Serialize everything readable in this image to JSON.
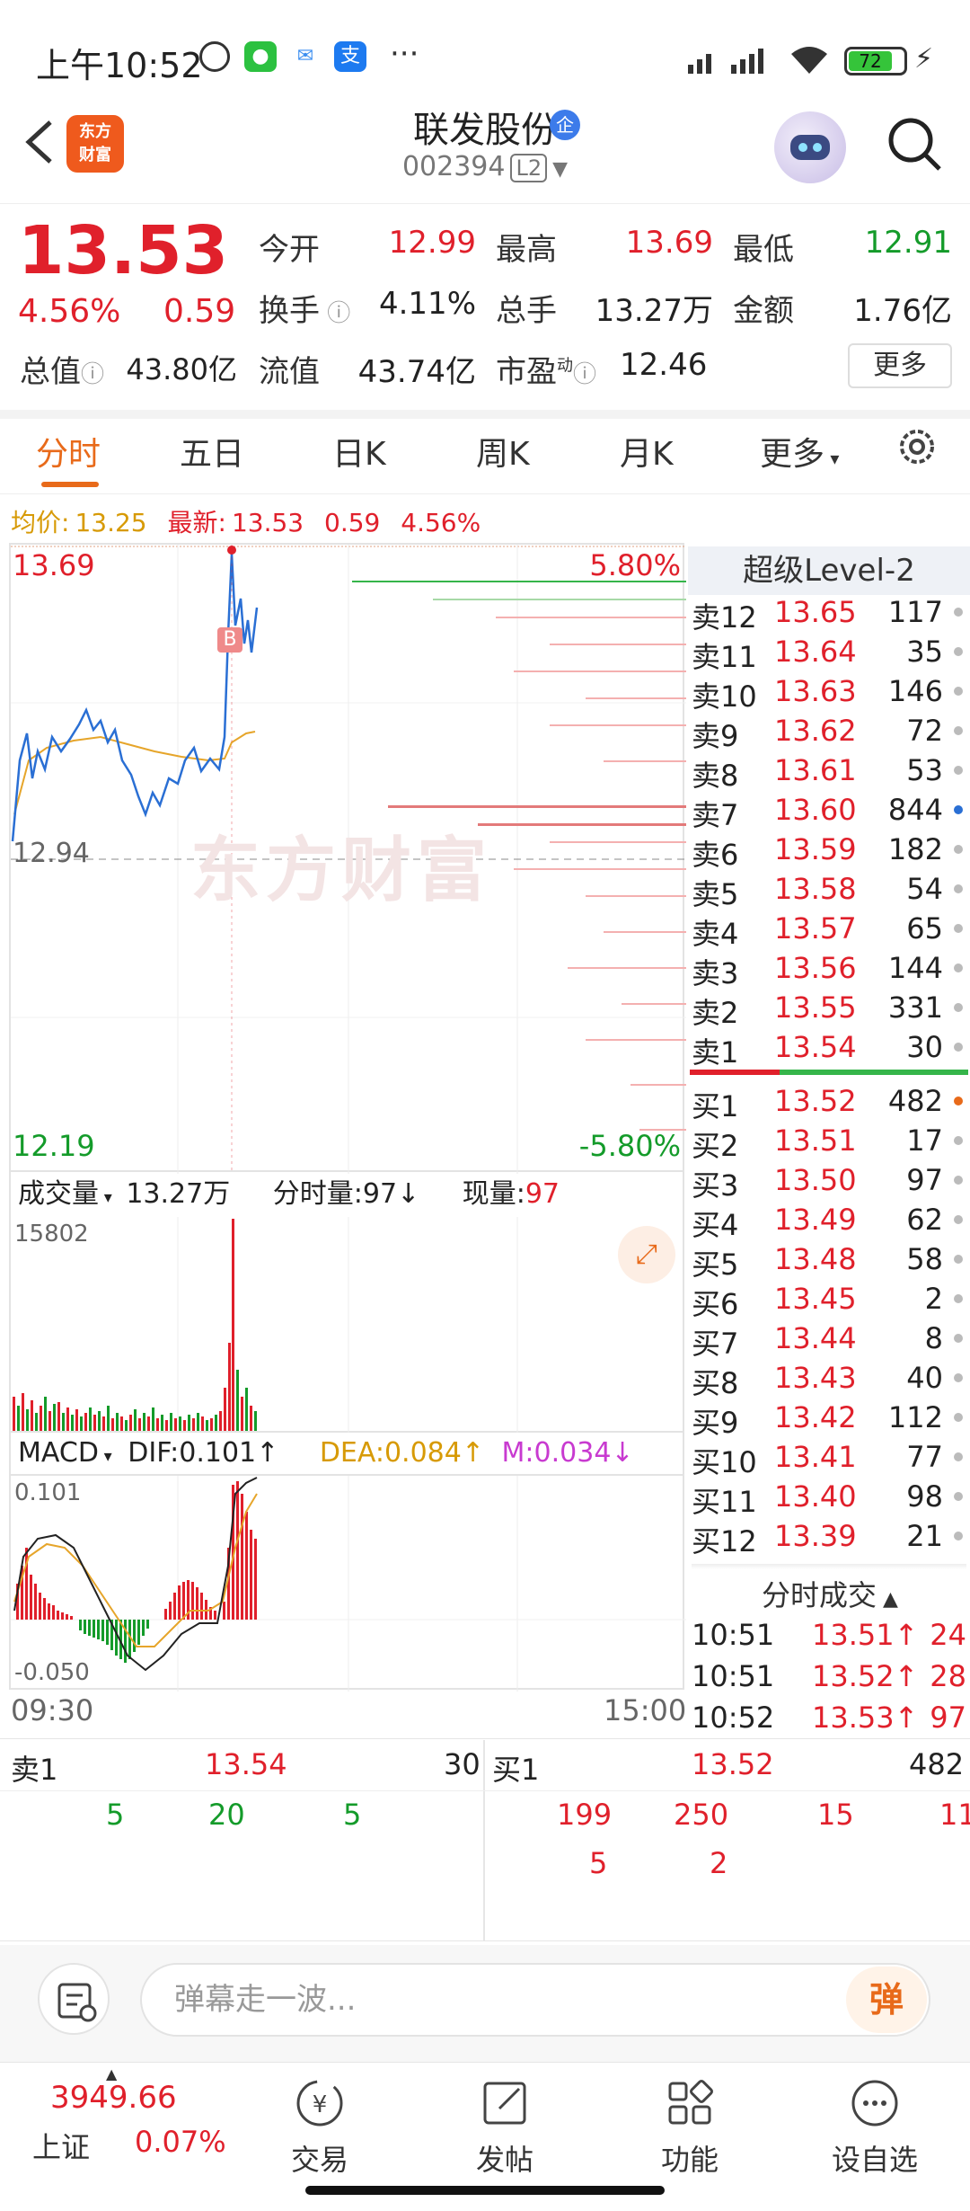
{
  "status": {
    "time": "上午10:52",
    "battery": "72"
  },
  "header": {
    "stock_name": "联发股份",
    "badge": "企",
    "code": "002394",
    "level": "L2",
    "logo_line1": "东方",
    "logo_line2": "财富"
  },
  "quote": {
    "price": "13.53",
    "pct": "4.56%",
    "chg": "0.59",
    "open_label": "今开",
    "open": "12.99",
    "high_label": "最高",
    "high": "13.69",
    "low_label": "最低",
    "low": "12.91",
    "turnover_label": "换手",
    "turnover": "4.11%",
    "volume_label": "总手",
    "volume": "13.27万",
    "amount_label": "金额",
    "amount": "1.76亿",
    "mcap_label": "总值",
    "mcap": "43.80亿",
    "float_label": "流值",
    "float": "43.74亿",
    "pe_label": "市盈",
    "pe_sup": "动",
    "pe": "12.46",
    "more": "更多"
  },
  "tabs": [
    "分时",
    "五日",
    "日K",
    "周K",
    "月K",
    "更多"
  ],
  "avg_line": {
    "avg_label": "均价:",
    "avg": "13.25",
    "latest_label": "最新:",
    "latest": "13.53",
    "chg": "0.59",
    "pct": "4.56%"
  },
  "chart": {
    "top_price": "13.69",
    "top_pct": "5.80%",
    "mid_price": "12.94",
    "bottom_price": "12.19",
    "bottom_pct": "-5.80%",
    "watermark": "东方财富",
    "marker": "B",
    "vol_label": "成交量",
    "vol_total": "13.27万",
    "vol_min_label": "分时量:",
    "vol_min": "97",
    "vol_now_label": "现量:",
    "vol_now": "97",
    "vol_max": "15802",
    "macd_label": "MACD",
    "dif": "DIF:0.101",
    "dea": "DEA:0.084",
    "m": "M:0.034",
    "macd_top": "0.101",
    "macd_bottom": "-0.050",
    "time_start": "09:30",
    "time_end": "15:00"
  },
  "order_book": {
    "title": "超级Level-2",
    "asks": [
      {
        "label": "卖12",
        "price": "13.65",
        "qty": "117"
      },
      {
        "label": "卖11",
        "price": "13.64",
        "qty": "35"
      },
      {
        "label": "卖10",
        "price": "13.63",
        "qty": "146"
      },
      {
        "label": "卖9",
        "price": "13.62",
        "qty": "72"
      },
      {
        "label": "卖8",
        "price": "13.61",
        "qty": "53"
      },
      {
        "label": "卖7",
        "price": "13.60",
        "qty": "844"
      },
      {
        "label": "卖6",
        "price": "13.59",
        "qty": "182"
      },
      {
        "label": "卖5",
        "price": "13.58",
        "qty": "54"
      },
      {
        "label": "卖4",
        "price": "13.57",
        "qty": "65"
      },
      {
        "label": "卖3",
        "price": "13.56",
        "qty": "144"
      },
      {
        "label": "卖2",
        "price": "13.55",
        "qty": "331"
      },
      {
        "label": "卖1",
        "price": "13.54",
        "qty": "30"
      }
    ],
    "bids": [
      {
        "label": "买1",
        "price": "13.52",
        "qty": "482"
      },
      {
        "label": "买2",
        "price": "13.51",
        "qty": "17"
      },
      {
        "label": "买3",
        "price": "13.50",
        "qty": "97"
      },
      {
        "label": "买4",
        "price": "13.49",
        "qty": "62"
      },
      {
        "label": "买5",
        "price": "13.48",
        "qty": "58"
      },
      {
        "label": "买6",
        "price": "13.45",
        "qty": "2"
      },
      {
        "label": "买7",
        "price": "13.44",
        "qty": "8"
      },
      {
        "label": "买8",
        "price": "13.43",
        "qty": "40"
      },
      {
        "label": "买9",
        "price": "13.42",
        "qty": "112"
      },
      {
        "label": "买10",
        "price": "13.41",
        "qty": "77"
      },
      {
        "label": "买11",
        "price": "13.40",
        "qty": "98"
      },
      {
        "label": "买12",
        "price": "13.39",
        "qty": "21"
      }
    ]
  },
  "ticks": {
    "title": "分时成交",
    "rows": [
      {
        "time": "10:51",
        "price": "13.51↑",
        "qty": "24"
      },
      {
        "time": "10:51",
        "price": "13.52↑",
        "qty": "28"
      },
      {
        "time": "10:52",
        "price": "13.53↑",
        "qty": "97"
      }
    ]
  },
  "level1": {
    "sell_label": "卖1",
    "sell_price": "13.54",
    "sell_qty": "30",
    "buy_label": "买1",
    "buy_price": "13.52",
    "buy_qty": "482",
    "sell_queue": [
      "5",
      "20",
      "5"
    ],
    "buy_queue_row1": [
      "199",
      "250",
      "15",
      "11"
    ],
    "buy_queue_row2": [
      "5",
      "2"
    ]
  },
  "danmu": {
    "placeholder": "弹幕走一波...",
    "button": "弹"
  },
  "bottom_nav": {
    "index_value": "3949.66",
    "index_name": "上证",
    "index_pct": "0.07%",
    "items": [
      "交易",
      "发帖",
      "功能",
      "设自选"
    ]
  },
  "colors": {
    "up": "#e0202b",
    "down": "#149b2a",
    "avg": "#d79a06",
    "accent": "#e86a1a"
  }
}
